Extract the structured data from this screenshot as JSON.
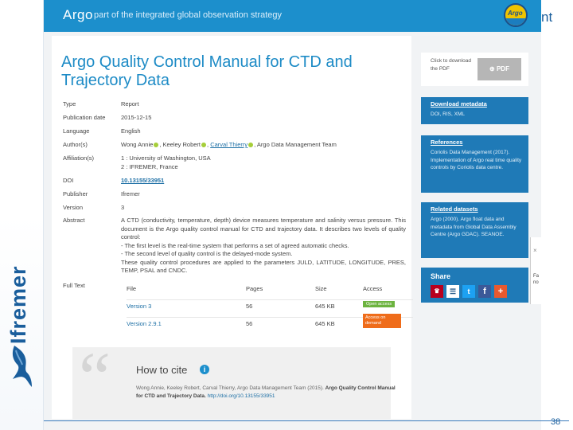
{
  "header": {
    "brand": "Argo",
    "tagline": "part of the integrated global observation strategy",
    "badge": "Argo"
  },
  "title": "Argo Quality Control Manual for CTD and Trajectory Data",
  "metadata": {
    "type_label": "Type",
    "type": "Report",
    "date_label": "Publication date",
    "date": "2015-12-15",
    "lang_label": "Language",
    "lang": "English",
    "authors_label": "Author(s)",
    "author1": "Wong Annie",
    "author2": "Keeley Robert",
    "author3": "Carval Thierry",
    "author4": "Argo Data Management Team",
    "affil_label": "Affiliation(s)",
    "affil1": "1 : University of Washington, USA",
    "affil2": "2 : IFREMER, France",
    "doi_label": "DOI",
    "doi": "10.13155/33951",
    "publisher_label": "Publisher",
    "publisher": "Ifremer",
    "version_label": "Version",
    "version": "3",
    "abstract_label": "Abstract",
    "abstract1": "A CTD (conductivity, temperature, depth) device measures temperature and salinity versus pressure. This document is the Argo quality control manual for CTD and trajectory data. It describes two levels of quality control:",
    "abstract2": "- The first level is the real-time system that performs a set of agreed automatic checks.",
    "abstract3": "- The second level of quality control is the delayed-mode system.",
    "abstract4": "These quality control procedures are applied to the parameters JULD, LATITUDE, LONGITUDE, PRES, TEMP, PSAL and CNDC.",
    "fulltext_label": "Full Text"
  },
  "fulltext": {
    "headers": [
      "File",
      "Pages",
      "Size",
      "Access"
    ],
    "rows": [
      {
        "file": "Version 3",
        "pages": "56",
        "size": "645 KB",
        "access": "Open access"
      },
      {
        "file": "Version 2.9.1",
        "pages": "56",
        "size": "645 KB",
        "access": "Access on demand"
      }
    ]
  },
  "cite": {
    "title": "How to cite",
    "info_icon": "i",
    "authors": "Wong Annie, Keeley Robert, Carval Thierry, Argo Data Management Team (2015).",
    "work": "Argo Quality Control Manual for CTD and Trajectory Data.",
    "url": "http://doi.org/10.13155/33951"
  },
  "sidebar": {
    "pdf_text": "Click to download the PDF",
    "pdf_button": "⊕ PDF",
    "download_title": "Download metadata",
    "download_body": "DOI, RIS, XML",
    "refs_title": "References",
    "refs_body": "Coriolis Data Management (2017). Implementation of Argo real time quality controls by Coriolis data centre.",
    "related_title": "Related datasets",
    "related_body": "Argo (2000). Argo float data and metadata from Global Data Assembly Centre (Argo GDAC). SEANOE.",
    "share_title": "Share"
  },
  "side_widget": {
    "close": "×",
    "text": "Fa no"
  },
  "slide": {
    "logo_text": "Ifremer",
    "title_fragment": "nt",
    "page_number": "38"
  },
  "colors": {
    "topbar": "#1c8fcc",
    "title": "#1d8bc6",
    "sidebar_box": "#1f7ab7",
    "open_access": "#6cb33f",
    "on_demand": "#ef6c1a",
    "ifremer": "#1a5e9c"
  },
  "icons": {
    "share": [
      "mendeley-icon",
      "menu-icon",
      "twitter-icon",
      "facebook-icon",
      "plus-icon"
    ]
  }
}
